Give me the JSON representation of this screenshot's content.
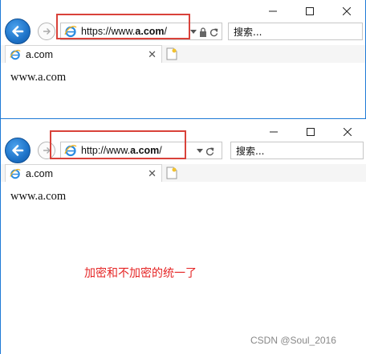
{
  "windows": [
    {
      "url_prefix": "https://www.",
      "url_domain": "a.com",
      "url_suffix": "/",
      "secure": true,
      "search_placeholder": "搜索...",
      "tab_title": "a.com",
      "content_text": "www.a.com"
    },
    {
      "url_prefix": "http://www.",
      "url_domain": "a.com",
      "url_suffix": "/",
      "secure": false,
      "search_placeholder": "搜索...",
      "tab_title": "a.com",
      "content_text": "www.a.com"
    }
  ],
  "annotation": "加密和不加密的统一了",
  "watermark": "CSDN @Soul_2016",
  "colors": {
    "highlight": "#d9423a",
    "annotation": "#e52525",
    "back_button": "#1e73c8"
  },
  "icons": [
    "minimize-icon",
    "maximize-icon",
    "close-icon",
    "back-arrow-icon",
    "forward-arrow-icon",
    "ie-logo-icon",
    "lock-icon",
    "dropdown-icon",
    "refresh-icon",
    "tab-close-icon",
    "new-tab-icon"
  ]
}
